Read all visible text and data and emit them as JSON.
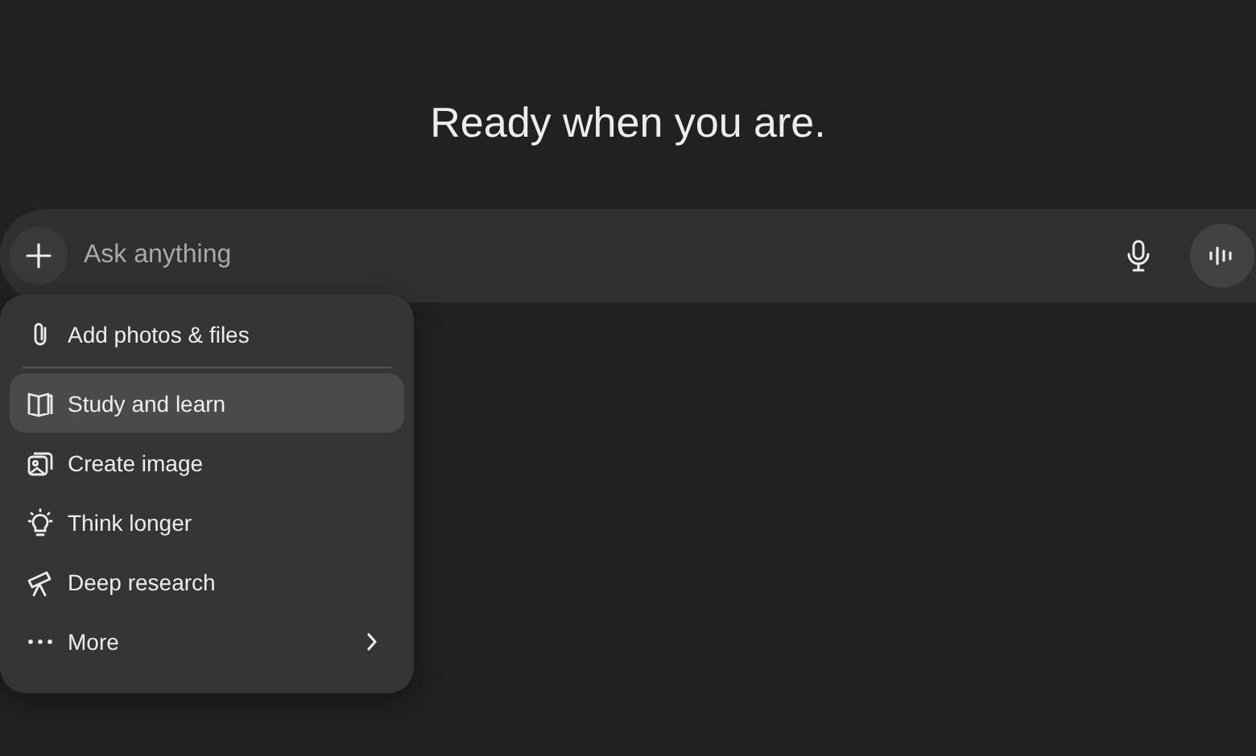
{
  "heading": "Ready when you are.",
  "composer": {
    "placeholder": "Ask anything"
  },
  "menu": [
    {
      "label": "Add photos & files",
      "kind": "attach",
      "selected": false,
      "divider_after": true
    },
    {
      "label": "Study and learn",
      "kind": "study",
      "selected": true
    },
    {
      "label": "Create image",
      "kind": "image",
      "selected": false
    },
    {
      "label": "Think longer",
      "kind": "think",
      "selected": false
    },
    {
      "label": "Deep research",
      "kind": "research",
      "selected": false
    },
    {
      "label": "More",
      "kind": "more",
      "selected": false,
      "submenu": true
    }
  ]
}
